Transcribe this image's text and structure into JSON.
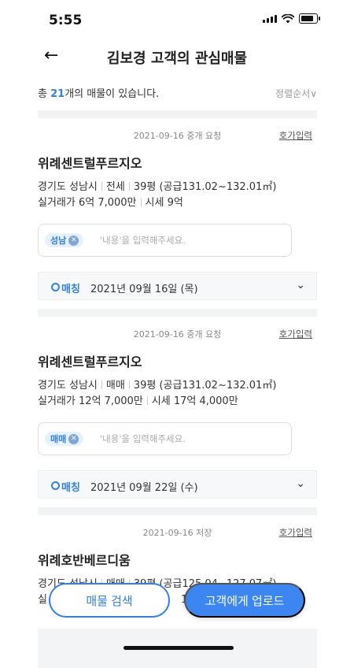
{
  "status": {
    "time": "5:55"
  },
  "header": {
    "title": "김보경 고객의 관심매물"
  },
  "summary": {
    "prefix": "총 ",
    "count": "21",
    "suffix": "개의 매물이 있습니다.",
    "sort": "정렬순서∨"
  },
  "cards": [
    {
      "meta": "2021-09-16 중개 요청",
      "link": "호가입력",
      "name": "위례센트럴푸르지오",
      "region": "경기도 성남시",
      "deal": "전세",
      "size": "39평 (공급131.02~132.01㎡)",
      "real_label": "실거래가 6억 7,000만",
      "market_label": "시세 9억",
      "chip": "성남",
      "memo_placeholder": "'내용'을 입력해주세요.",
      "match_label": "매칭",
      "match_date": "2021년 09월 16일 (목)"
    },
    {
      "meta": "2021-09-16 중개 요청",
      "link": "호가입력",
      "name": "위례센트럴푸르지오",
      "region": "경기도 성남시",
      "deal": "매매",
      "size": "39평 (공급131.02~132.01㎡)",
      "real_label": "실거래가 12억 7,000만",
      "market_label": "시세 17억 4,000만",
      "chip": "매매",
      "memo_placeholder": "'내용'을 입력해주세요.",
      "match_label": "매칭",
      "match_date": "2021년 09월 22일 (수)"
    },
    {
      "meta": "2021-09-16 저장",
      "link": "호가입력",
      "name": "위례호반베르디움",
      "region": "경기도 성남시",
      "deal": "매매",
      "size": "39평 (공급125.04~127.07㎡)",
      "real_label": "실",
      "market_label": "1("
    }
  ],
  "buttons": {
    "search": "매물 검색",
    "upload": "고객에게 업로드"
  },
  "icons": {
    "back": "back-arrow-icon",
    "chip_remove": "close-circle-icon",
    "chevron": "chevron-down-icon"
  },
  "colors": {
    "accent": "#2f80ed"
  }
}
